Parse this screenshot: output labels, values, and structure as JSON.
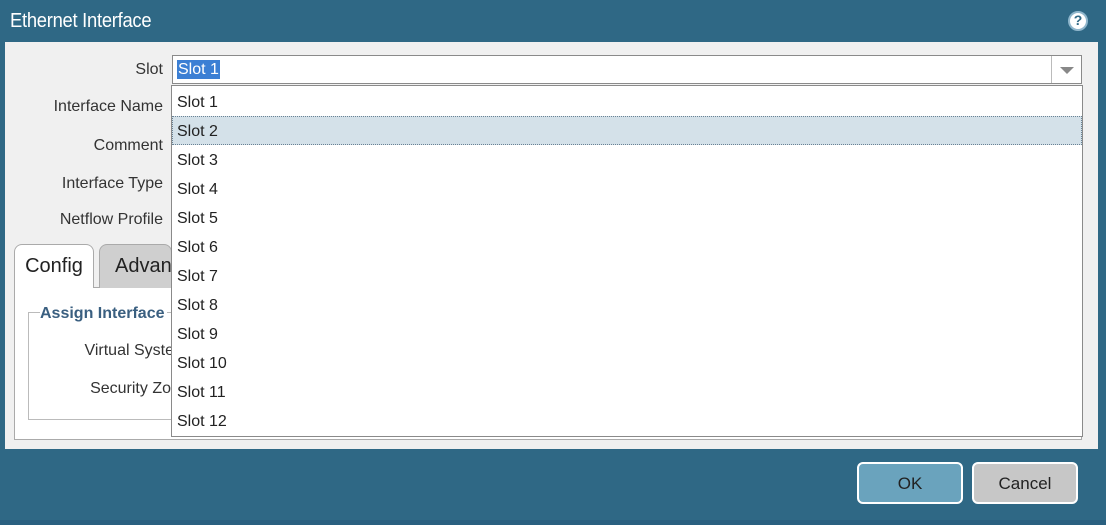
{
  "dialog": {
    "title": "Ethernet Interface",
    "help_icon": "help-icon"
  },
  "form": {
    "slot_label": "Slot",
    "slot_value": "Slot 1",
    "interface_name_label": "Interface Name",
    "comment_label": "Comment",
    "interface_type_label": "Interface Type",
    "netflow_profile_label": "Netflow Profile"
  },
  "tabs": [
    {
      "label": "Config",
      "active": true
    },
    {
      "label": "Advanc",
      "active": false
    }
  ],
  "config": {
    "section_title": "Assign Interface",
    "virtual_system_label": "Virtual Syste",
    "security_zone_label": "Security Zo"
  },
  "slot_dropdown": {
    "options": [
      "Slot 1",
      "Slot 2",
      "Slot 3",
      "Slot 4",
      "Slot 5",
      "Slot 6",
      "Slot 7",
      "Slot 8",
      "Slot 9",
      "Slot 10",
      "Slot 11",
      "Slot 12"
    ],
    "hovered": "Slot 2"
  },
  "buttons": {
    "ok": "OK",
    "cancel": "Cancel"
  },
  "colors": {
    "frame": "#2f6885",
    "selection": "#3b7fd4",
    "hover_row": "#d4e1e9",
    "ok_button": "#6aa3bd"
  }
}
